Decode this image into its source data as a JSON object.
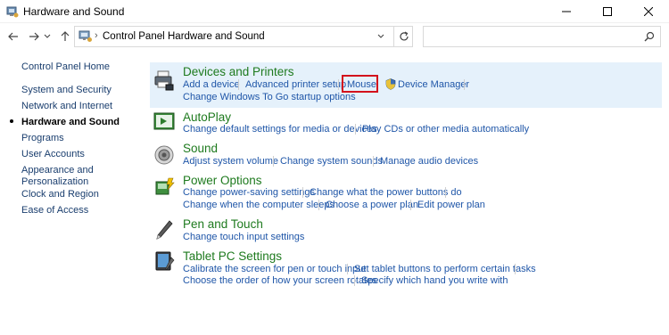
{
  "window": {
    "title": "Hardware and Sound",
    "app_icon": "control-panel-icon",
    "buttons": [
      "minimize-icon",
      "maximize-icon",
      "close-icon"
    ]
  },
  "address_bar": {
    "breadcrumb": [
      "Control Panel",
      "Hardware and Sound"
    ],
    "search_placeholder": "",
    "nav_icons": [
      "back-icon",
      "forward-icon",
      "recent-dropdown-icon",
      "up-icon",
      "refresh-icon",
      "search-icon"
    ]
  },
  "left_nav": {
    "items": [
      {
        "label": "Control Panel Home",
        "current": false
      },
      {
        "label": "System and Security",
        "current": false
      },
      {
        "label": "Network and Internet",
        "current": false
      },
      {
        "label": "Hardware and Sound",
        "current": true
      },
      {
        "label": "Programs",
        "current": false
      },
      {
        "label": "User Accounts",
        "current": false
      },
      {
        "label": "Appearance and",
        "label2": "Personalization",
        "current": false
      },
      {
        "label": "Clock and Region",
        "current": false
      },
      {
        "label": "Ease of Access",
        "current": false
      }
    ]
  },
  "categories": [
    {
      "title": "Devices and Printers",
      "icon": "printer-icon",
      "links": [
        "Add a device",
        "Advanced printer setup",
        "Mouse",
        "Device Manager",
        "Change Windows To Go startup options"
      ],
      "highlighted_link": "Mouse"
    },
    {
      "title": "AutoPlay",
      "icon": "autoplay-icon",
      "links": [
        "Change default settings for media or devices",
        "Play CDs or other media automatically"
      ]
    },
    {
      "title": "Sound",
      "icon": "speaker-icon",
      "links": [
        "Adjust system volume",
        "Change system sounds",
        "Manage audio devices"
      ]
    },
    {
      "title": "Power Options",
      "icon": "power-options-icon",
      "links": [
        "Change power-saving settings",
        "Change what the power buttons do",
        "Change when the computer sleeps",
        "Choose a power plan",
        "Edit power plan"
      ]
    },
    {
      "title": "Pen and Touch",
      "icon": "pen-icon",
      "links": [
        "Change touch input settings"
      ]
    },
    {
      "title": "Tablet PC Settings",
      "icon": "tablet-icon",
      "links": [
        "Calibrate the screen for pen or touch input",
        "Set tablet buttons to perform certain tasks",
        "Choose the order of how your screen rotates",
        "Specify which hand you write with"
      ]
    }
  ],
  "colors": {
    "link": "#1f56a8",
    "category_title": "#1e7a1e",
    "selected_background": "#e5f1fb",
    "highlight_border": "#d3111c"
  }
}
